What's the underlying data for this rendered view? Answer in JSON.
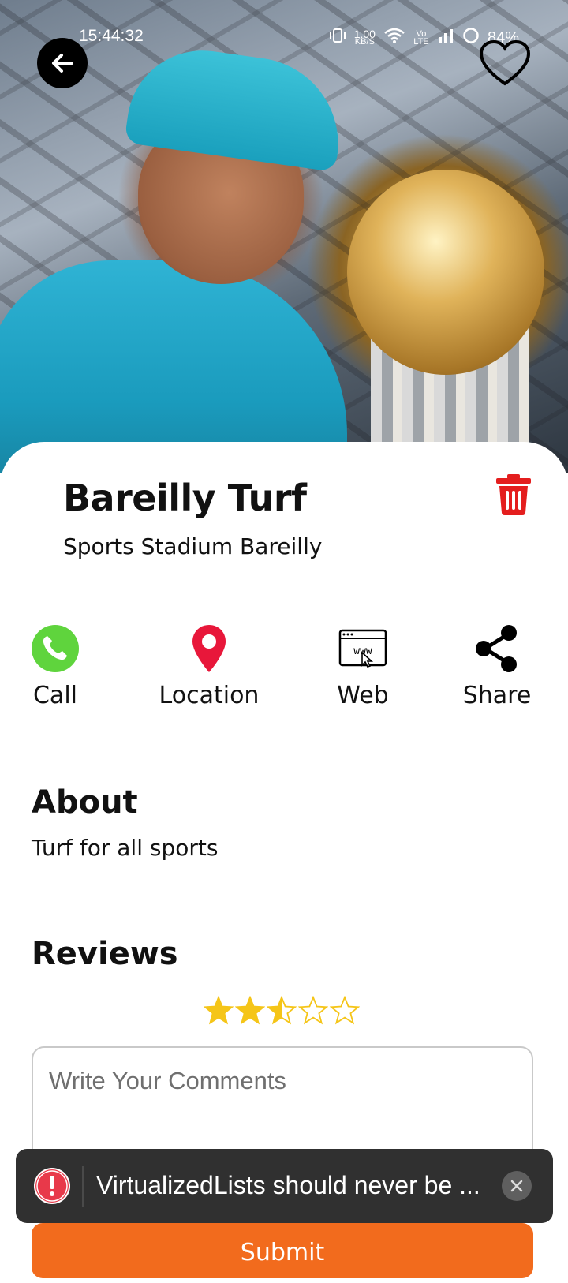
{
  "status_bar": {
    "time": "15:44:32",
    "data_rate_value": "1.00",
    "data_rate_unit": "KB/S",
    "network_label": "Vo LTE",
    "battery": "84%"
  },
  "header": {
    "back_icon": "arrow-left-icon",
    "favorite_icon": "heart-outline-icon",
    "hero_image_description": "cricket player with world cup trophy"
  },
  "venue": {
    "title": "Bareilly Turf",
    "subtitle": "Sports Stadium Bareilly",
    "delete_icon": "trash-icon"
  },
  "actions": [
    {
      "label": "Call",
      "icon": "phone-icon",
      "color": "#5fd43d"
    },
    {
      "label": "Location",
      "icon": "map-pin-icon",
      "color": "#e8173a"
    },
    {
      "label": "Web",
      "icon": "www-browser-icon",
      "color": "#000000"
    },
    {
      "label": "Share",
      "icon": "share-icon",
      "color": "#000000"
    }
  ],
  "about": {
    "heading": "About",
    "text": "Turf for all sports"
  },
  "reviews": {
    "heading": "Reviews",
    "rating": 2.5,
    "max_rating": 5,
    "comment_placeholder": "Write Your Comments",
    "submit_label": "Submit"
  },
  "toast": {
    "message": "VirtualizedLists should never be ...",
    "icon": "warning-icon",
    "close_icon": "close-icon"
  },
  "colors": {
    "accent_orange": "#f26b1d",
    "delete_red": "#e41e1e",
    "star_gold": "#f5c518"
  }
}
